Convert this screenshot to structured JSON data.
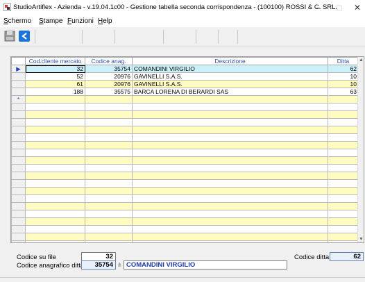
{
  "window": {
    "title": "StudioArtiflex - Azienda - v.19.04.1c00 - Gestione tabella seconda corrispondenza - (100100) ROSSI & C. SRL.",
    "minimize": "–",
    "maximize": "□",
    "close": "✕"
  },
  "menu": {
    "items": [
      {
        "label": "Schermo",
        "accel": "S",
        "rest": "chermo"
      },
      {
        "label": "Stampe",
        "accel": "S",
        "rest": "tampe"
      },
      {
        "label": "Funzioni",
        "accel": "F",
        "rest": "unzioni"
      },
      {
        "label": "Help",
        "accel": "H",
        "rest": "elp"
      }
    ]
  },
  "toolbar": {
    "buttons": [
      {
        "icon": "save-disk-icon"
      },
      {
        "icon": "back-arrow-icon",
        "color": "#1a74d9"
      }
    ]
  },
  "grid": {
    "columns": [
      "Cod.cliente mercato",
      "Codice anag.",
      "Descrizione",
      "Ditta"
    ],
    "rows": [
      {
        "indicator": "▶",
        "cod_cliente": "32",
        "codice_anag": "35754",
        "descrizione": "COMANDINI VIRGILIO",
        "ditta": "62"
      },
      {
        "indicator": "",
        "cod_cliente": "52",
        "codice_anag": "20976",
        "descrizione": "GAVINELLI S.A.S.",
        "ditta": "10"
      },
      {
        "indicator": "",
        "cod_cliente": "61",
        "codice_anag": "20976",
        "descrizione": "GAVINELLI S.A.S.",
        "ditta": "10"
      },
      {
        "indicator": "",
        "cod_cliente": "188",
        "codice_anag": "35575",
        "descrizione": "BARCA LORENA DI BERARDI SAS",
        "ditta": "63"
      },
      {
        "indicator": "*",
        "cod_cliente": "",
        "codice_anag": "",
        "descrizione": "",
        "ditta": ""
      }
    ],
    "empty_rows": 19,
    "row_colors": {
      "selected": "#ccf0fa",
      "yellow": "#fffcc2",
      "white": "#ffffff"
    }
  },
  "footer": {
    "codice_su_file_label": "Codice su file",
    "codice_su_file_value": "32",
    "codice_anagrafico_label": "Codice anagrafico ditta",
    "codice_anagrafico_value": "35754",
    "descrizione_value": "COMANDINI VIRGILIO",
    "codice_ditta_label": "Codice ditta",
    "codice_ditta_value": "62"
  }
}
